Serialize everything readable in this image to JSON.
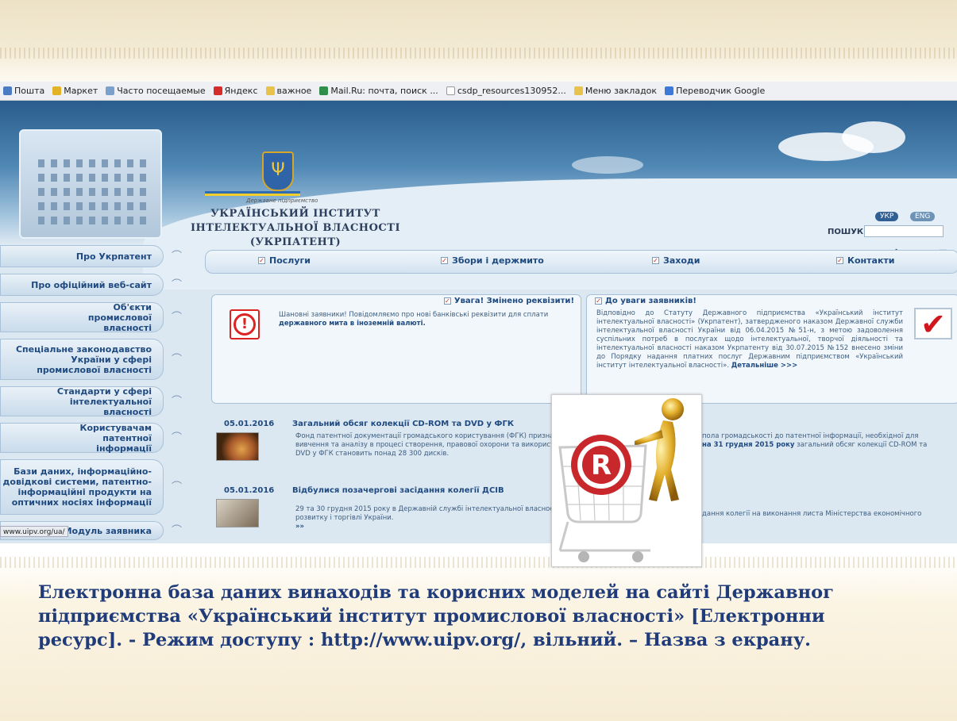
{
  "bookmarks": [
    "Пошта",
    "Маркет",
    "Часто посещаемые",
    "Яндекс",
    "важное",
    "Mail.Ru: почта, поиск ...",
    "csdp_resources130952...",
    "Меню закладок",
    "Переводчик Google"
  ],
  "header": {
    "org_small": "Державне підприємство",
    "org_line1": "УКРАЇНСЬКИЙ ІНСТИТУТ",
    "org_line2": "ІНТЕЛЕКТУАЛЬНОЇ ВЛАСНОСТІ",
    "org_line3": "(УКРПАТЕНТ)",
    "lang_ukr": "УКР",
    "lang_eng": "ENG",
    "search_label": "ПОШУК",
    "search_value": ""
  },
  "nav": [
    "Про Укрпатент",
    "Про офіційний веб-сайт",
    "Об'єкти промислової власності",
    "Спеціальне законодавство України у сфері промислової власності",
    "Стандарти у сфері інтелектуальної власності",
    "Користувачам патентної інформації",
    "Бази даних, інформаційно-довідкові системи, патентно-інформаційні продукти на оптичних носіях інформації",
    "Модуль заявника"
  ],
  "status_url": "www.uipv.org/ua/",
  "menu": [
    "Послуги",
    "Збори і держмито",
    "Заходи",
    "Контакти"
  ],
  "alert_panel": {
    "title": "Увага! Змінено реквізити!",
    "text": "Шановні заявники! Повідомляємо про нові банківські реквізити для сплати",
    "text_bold": "державного мита в іноземній валюті."
  },
  "notice_panel": {
    "title": "До уваги заявників!",
    "text": "Відповідно до Статуту Державного підприємства «Український інститут інтелектуальної власності» (Укрпатент), затвердженого наказом Державної служби інтелектуальної власності України від 06.04.2015 №51-н, з метою задоволення суспільних потреб в послугах щодо інтелектуальної, творчої діяльності та інтелектуальної власності наказом Укрпатенту від 30.07.2015 №152 внесено зміни до Порядку надання платних послуг Державним підприємством «Український інститут інтелектуальної власності».",
    "more": "Детальніше >>>"
  },
  "news": [
    {
      "date": "05.01.2016",
      "title": "Загальний обсяг колекції CD-ROM та DVD у ФГК",
      "text1": "Фонд патентної документації громадського користування (ФГК) призначений",
      "text2": "вивчення та аналізу в процесі створення, правової охорони та використання",
      "text3": "DVD у ФГК становить понад 28 300 дисків.",
      "tail1": "пола громадськості до патентної інформації, необхідної для",
      "tail2_bold": "на 31 грудня 2015 року",
      "tail2": "загальний обсяг колекції CD-ROM та"
    },
    {
      "date": "05.01.2016",
      "title": "Відбулися позачергові засідання колегії ДСІВ",
      "text1": "29 та 30 грудня 2015 року в Державній службі інтелектуальної власності Ук",
      "text2": "розвитку і торгівлі України.",
      "more": "»»",
      "tail1": "дання колегії на виконання листа Міністерства економічного"
    }
  ],
  "caption": {
    "line1": "Електронна база даних винаходів та корисних моделей на сайті Державног",
    "line2": "підприємства «Український інститут промислової власності» [Електронни",
    "line3": "ресурс]. - Режим доступу : http://www.uipv.org/, вільний. – Назва з екрану."
  },
  "colors": {
    "accent": "#1f3b79",
    "nav_text": "#1f4a80",
    "alert_red": "#d2141c"
  }
}
